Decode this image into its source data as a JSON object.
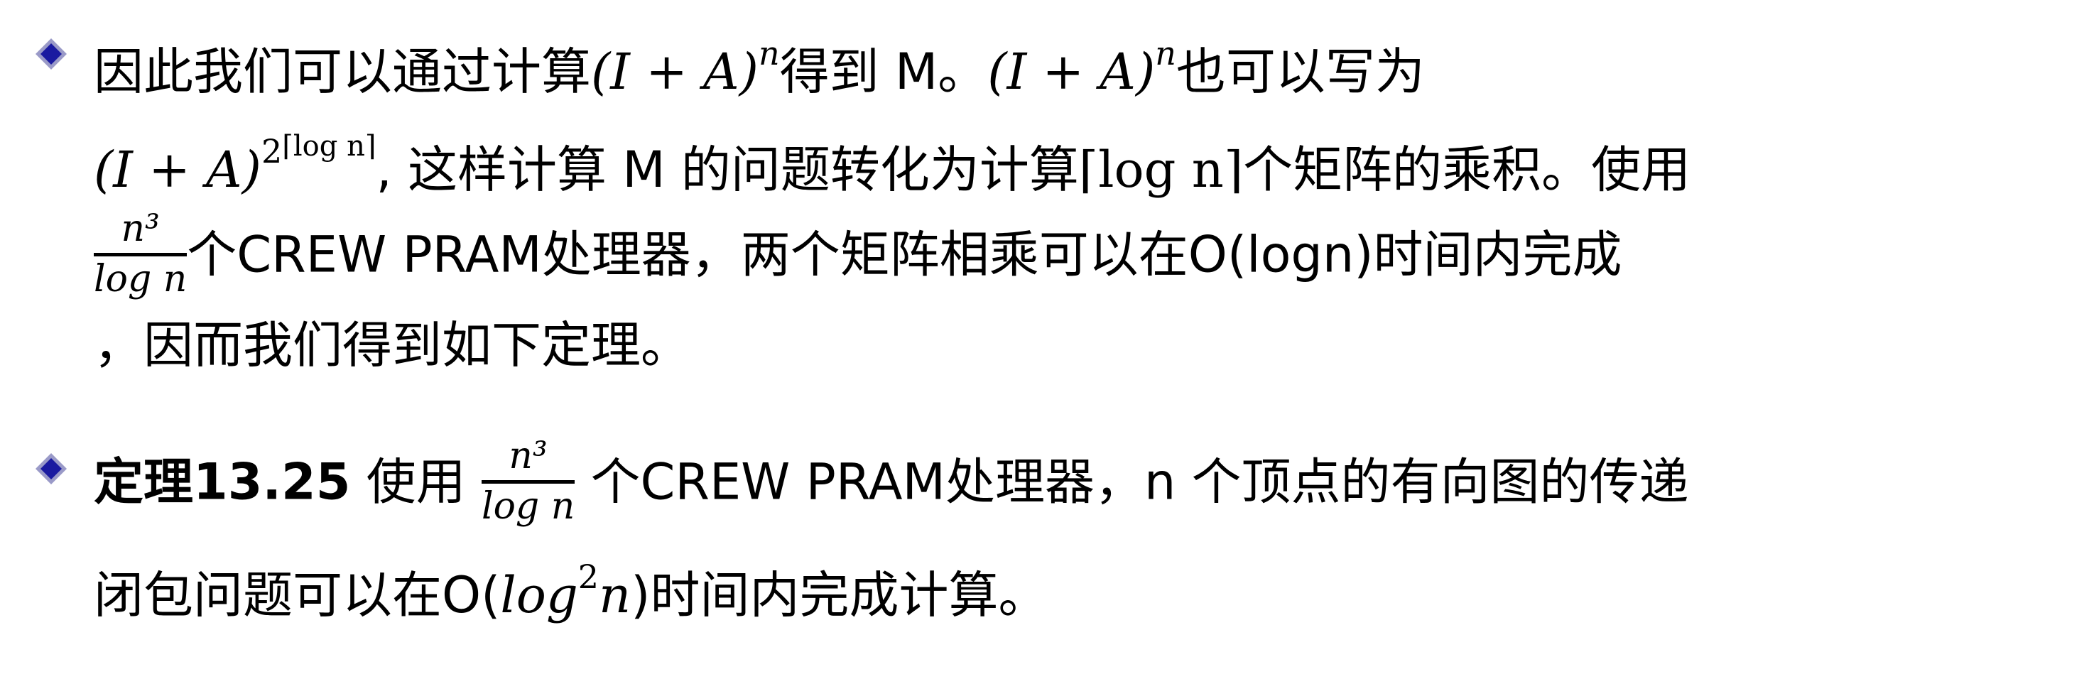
{
  "bullet1": {
    "l1": {
      "t1": "因此我们可以通过计算",
      "m1_base": "(I + A)",
      "m1_exp": "n",
      "t2": "得到 M。",
      "m2_base": "(I + A)",
      "m2_exp": "n",
      "t3": "也可以写为"
    },
    "l2": {
      "m_base": "(I + A)",
      "m_exp_base": "2",
      "m_exp_sup": "⌈log n⌉",
      "t1": ", 这样计算 M 的问题转化为计算",
      "m_ceil": "⌈log n⌉",
      "t2": "个矩阵的乘积。使用"
    },
    "l3": {
      "frac_num": "n³",
      "frac_den": "log n",
      "t1": "个CREW PRAM处理器，两个矩阵相乘可以在O(logn)时间内完成"
    },
    "l4": {
      "t1": "，因而我们得到如下定理。"
    }
  },
  "bullet2": {
    "l1": {
      "bold": "定理13.25",
      "t1": " 使用 ",
      "frac_num": "n³",
      "frac_den": "log n",
      "t2": " 个CREW PRAM处理器，n 个顶点的有向图的传递"
    },
    "l2": {
      "t1": "闭包问题可以在O(",
      "m_log": "log",
      "m_exp": "2",
      "m_n": "n",
      "t2": ")时间内完成计算。"
    }
  },
  "colors": {
    "bullet_fill": "#1a1aa0",
    "bullet_edge": "#9a9ac8",
    "text": "#000000"
  }
}
